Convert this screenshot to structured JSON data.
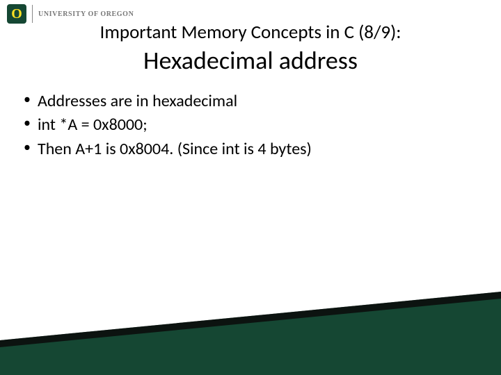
{
  "header": {
    "logo_letter": "O",
    "university": "UNIVERSITY OF OREGON"
  },
  "title": {
    "line1": "Important Memory Concepts in C (8/9):",
    "line2": "Hexadecimal address"
  },
  "bullets": [
    "Addresses are in hexadecimal",
    "int *A = 0x8000;",
    "Then A+1 is 0x8004.  (Since int is 4 bytes)"
  ],
  "colors": {
    "brand_green": "#154733",
    "brand_yellow": "#FEE123"
  }
}
